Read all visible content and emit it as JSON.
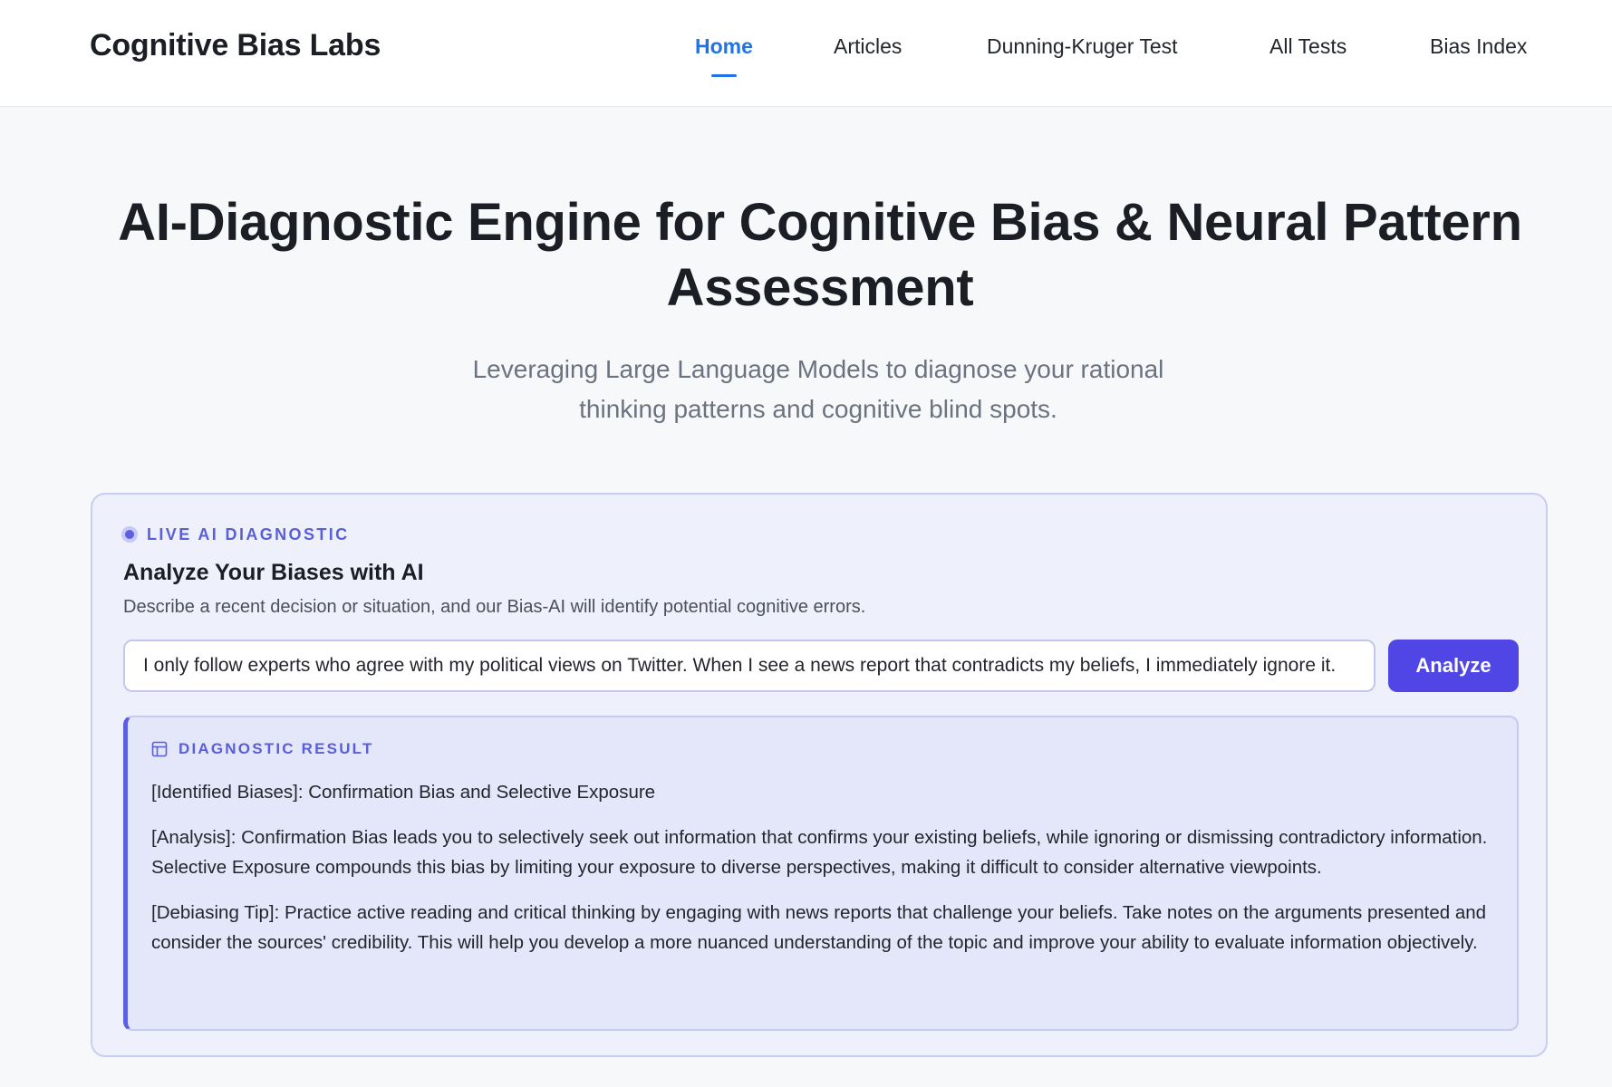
{
  "brand": "Cognitive Bias Labs",
  "nav": {
    "items": [
      {
        "label": "Home",
        "active": true
      },
      {
        "label": "Articles",
        "active": false
      },
      {
        "label": "Dunning-Kruger Test",
        "active": false
      },
      {
        "label": "All Tests",
        "active": false
      },
      {
        "label": "Bias Index",
        "active": false
      }
    ]
  },
  "hero": {
    "title": "AI-Diagnostic Engine for Cognitive Bias & Neural Pattern Assessment",
    "subtitle": "Leveraging Large Language Models to diagnose your rational thinking patterns and cognitive blind spots."
  },
  "diagnostic": {
    "live_label": "LIVE AI DIAGNOSTIC",
    "title": "Analyze Your Biases with AI",
    "description": "Describe a recent decision or situation, and our Bias-AI will identify potential cognitive errors.",
    "input_value": "I only follow experts who agree with my political views on Twitter. When I see a news report that contradicts my beliefs, I immediately ignore it.",
    "analyze_label": "Analyze",
    "result": {
      "label": "DIAGNOSTIC RESULT",
      "biases": "[Identified Biases]: Confirmation Bias and Selective Exposure",
      "analysis": "[Analysis]: Confirmation Bias leads you to selectively seek out information that confirms your existing beliefs, while ignoring or dismissing contradictory information. Selective Exposure compounds this bias by limiting your exposure to diverse perspectives, making it difficult to consider alternative viewpoints.",
      "tip": "[Debiasing Tip]: Practice active reading and critical thinking by engaging with news reports that challenge your beliefs. Take notes on the arguments presented and consider the sources' credibility. This will help you develop a more nuanced understanding of the topic and improve your ability to evaluate information objectively."
    }
  },
  "colors": {
    "accent": "#1f73e6",
    "brand_purple": "#4f46e5",
    "card_bg": "#eef0fb",
    "result_bg": "#e4e6f9"
  }
}
